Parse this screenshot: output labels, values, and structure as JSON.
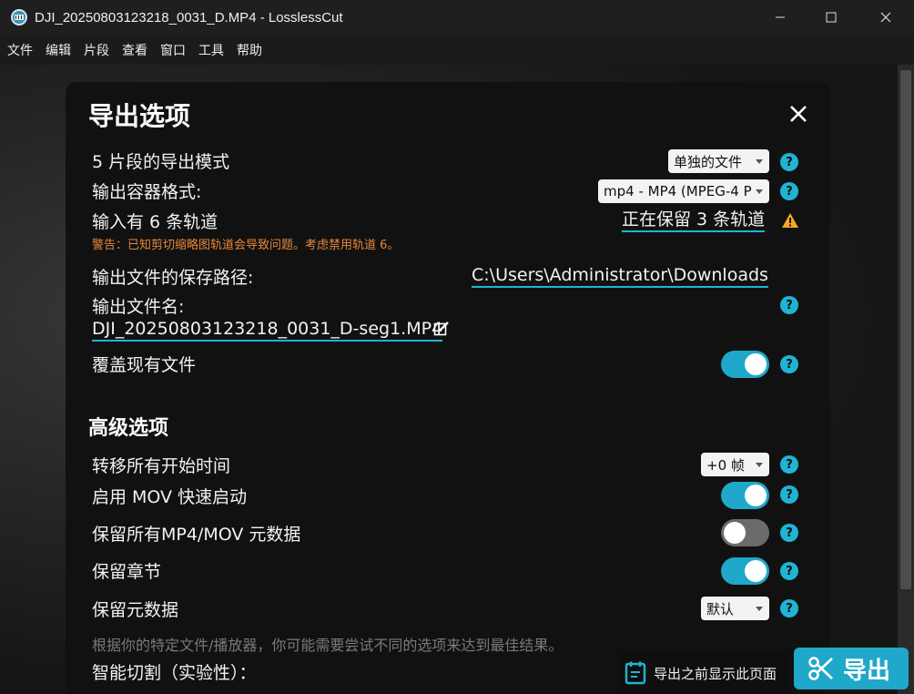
{
  "window": {
    "title": "DJI_20250803123218_0031_D.MP4 - LosslessCut",
    "controls": [
      "minimize",
      "maximize",
      "close"
    ]
  },
  "menu": {
    "file": "文件",
    "edit": "编辑",
    "segment": "片段",
    "view": "查看",
    "window": "窗口",
    "tools": "工具",
    "help": "帮助"
  },
  "dialog": {
    "title": "导出选项",
    "export_mode": {
      "label": "5 片段的导出模式",
      "value": "单独的文件"
    },
    "container_format": {
      "label": "输出容器格式:",
      "value": "mp4 - MP4 (MPEG-4 P"
    },
    "tracks": {
      "label": "输入有 6 条轨道",
      "link": "正在保留 3 条轨道",
      "warning": "警告：已知剪切缩略图轨道会导致问题。考虑禁用轨道 6。"
    },
    "output_path": {
      "label": "输出文件的保存路径:",
      "value": "C:\\Users\\Administrator\\Downloads"
    },
    "output_name": {
      "label": "输出文件名:",
      "value": "DJI_20250803123218_0031_D-seg1.MP4"
    },
    "overwrite": {
      "label": "覆盖现有文件",
      "enabled": true
    },
    "advanced_title": "高级选项",
    "shift_start": {
      "label": "转移所有开始时间",
      "value": "+0 帧"
    },
    "mov_faststart": {
      "label": "启用 MOV 快速启动",
      "enabled": true
    },
    "keep_mp4_meta": {
      "label": "保留所有MP4/MOV 元数据",
      "enabled": false
    },
    "keep_chapters": {
      "label": "保留章节",
      "enabled": true
    },
    "keep_metadata": {
      "label": "保留元数据",
      "value": "默认"
    },
    "hint": "根据你的特定文件/播放器，你可能需要尝试不同的选项来达到最佳结果。",
    "smart_cut": {
      "label": "智能切割（实验性）："
    },
    "help_glyph": "?"
  },
  "footer": {
    "show_before_label": "导出之前显示此页面",
    "export_label": "导出"
  },
  "colors": {
    "accent": "#1fa8c9",
    "warning": "#e8883a",
    "dialog_bg": "#111111"
  }
}
